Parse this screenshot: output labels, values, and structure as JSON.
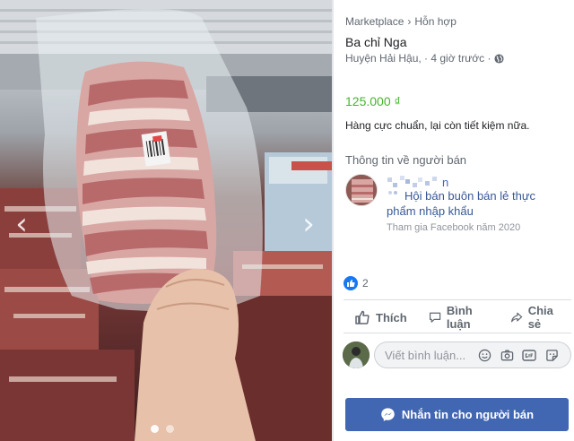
{
  "breadcrumb": {
    "root": "Marketplace",
    "separator": "›",
    "category": "Hỗn hợp"
  },
  "listing": {
    "title": "Ba chỉ Nga",
    "location_time": "Huyện Hải Hậu, · 4 giờ trước ·",
    "price": "125.000 ₫",
    "description": "Hàng cực chuẩn, lại còn tiết kiệm nữa."
  },
  "seller": {
    "section_title": "Thông tin về người bán",
    "name_visible": "n",
    "group_name": "Hội bán buôn bán lẻ thực phẩm nhập khẩu",
    "joined": "Tham gia Facebook năm 2020"
  },
  "reactions": {
    "count": "2"
  },
  "actions": {
    "like": "Thích",
    "comment": "Bình luận",
    "share": "Chia sẻ"
  },
  "comment": {
    "placeholder": "Viết bình luận..."
  },
  "message_button": {
    "label": "Nhắn tin cho người bán"
  },
  "photo": {
    "prev_arrow": "‹",
    "next_arrow": "›",
    "dot_count": 2,
    "active_dot": 1
  },
  "colors": {
    "price": "#42b72a",
    "link": "#385898",
    "button": "#4267b2",
    "like": "#1877f2"
  }
}
